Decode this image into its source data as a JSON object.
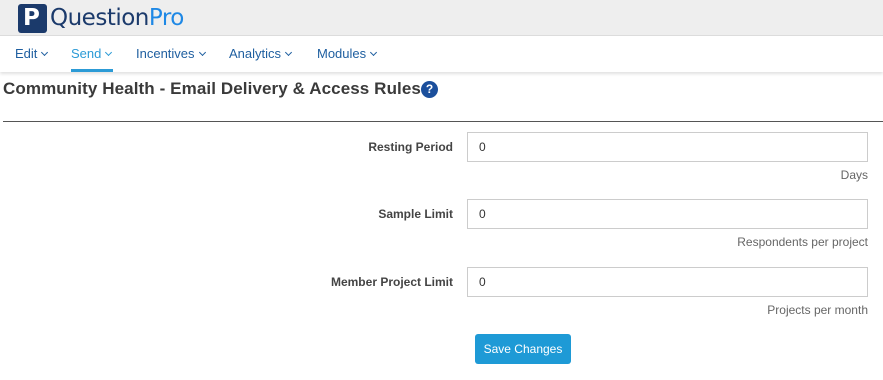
{
  "brand": {
    "name_part1": "Question",
    "name_part2": "Pro",
    "mark_letter": "P"
  },
  "nav": {
    "items": [
      {
        "label": "Edit"
      },
      {
        "label": "Send",
        "active": true
      },
      {
        "label": "Incentives"
      },
      {
        "label": "Analytics"
      },
      {
        "label": "Modules"
      }
    ]
  },
  "page": {
    "title": "Community Health - Email Delivery & Access Rules",
    "help_icon": "question-circle-icon"
  },
  "fields": [
    {
      "label": "Resting Period",
      "value": "0",
      "help": "Days"
    },
    {
      "label": "Sample Limit",
      "value": "0",
      "help": "Respondents per project"
    },
    {
      "label": "Member Project Limit",
      "value": "0",
      "help": "Projects per month"
    }
  ],
  "actions": {
    "save_label": "Save Changes"
  },
  "colors": {
    "brand_dark": "#1b3a6b",
    "accent": "#2c9bd6",
    "button": "#1e9ad6"
  }
}
